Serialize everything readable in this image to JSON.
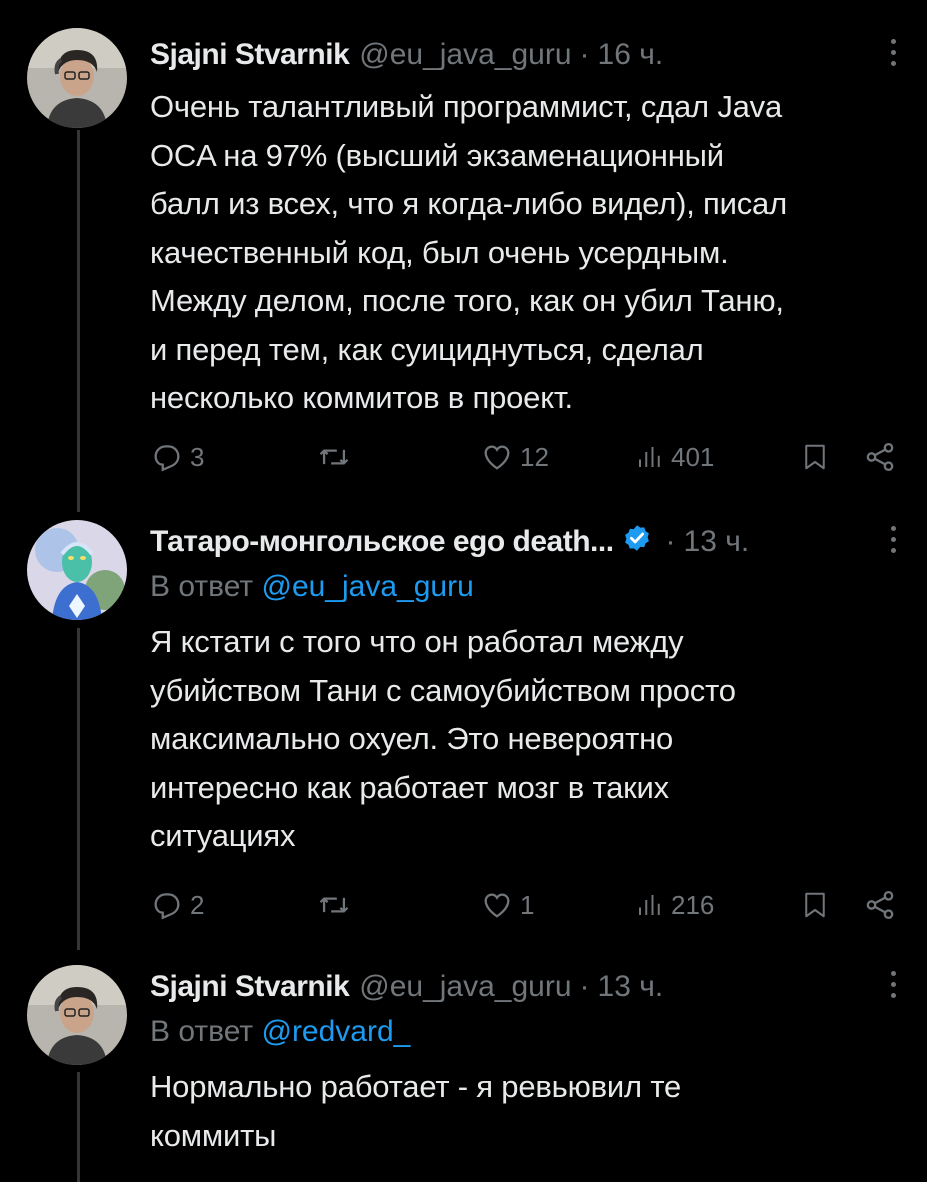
{
  "tweets": [
    {
      "name": "Sjajni Stvarnik",
      "handle": "@eu_java_guru",
      "dot": "·",
      "time": "16 ч.",
      "lines": [
        "Очень талантливый программист, сдал Java",
        "OCA на 97% (высший экзаменационный",
        "балл из всех, что я когда-либо видел), писал",
        "качественный код, был очень усердным.",
        "Между делом, после того, как он убил Таню,",
        "и перед тем, как суициднуться, сделал",
        "несколько коммитов в проект."
      ],
      "replies": "3",
      "likes": "12",
      "views": "401"
    },
    {
      "name": "Татаро-монгольское ego death...",
      "verified": true,
      "dot": "·",
      "time": "13 ч.",
      "reply_prefix": "В ответ",
      "reply_mention": "@eu_java_guru",
      "lines": [
        "Я кстати с того что он работал между",
        "убийством Тани с самоубийством просто",
        "максимально охуел. Это невероятно",
        "интересно как работает мозг в таких",
        "ситуациях"
      ],
      "replies": "2",
      "likes": "1",
      "views": "216"
    },
    {
      "name": "Sjajni Stvarnik",
      "handle": "@eu_java_guru",
      "dot": "·",
      "time": "13 ч.",
      "reply_prefix": "В ответ",
      "reply_mention": "@redvard_",
      "lines": [
        "Нормально работает - я ревьювил те",
        "коммиты"
      ]
    }
  ],
  "icons": {
    "reply": "reply-icon",
    "retweet": "retweet-icon",
    "like": "like-icon",
    "views": "views-icon",
    "bookmark": "bookmark-icon",
    "share": "share-icon",
    "more": "more-icon",
    "verified": "verified-badge-icon"
  },
  "colors": {
    "background": "#000000",
    "text": "#e7e9ea",
    "secondary": "#71767b",
    "accent": "#1d9bf0",
    "thread_line": "#333639"
  }
}
